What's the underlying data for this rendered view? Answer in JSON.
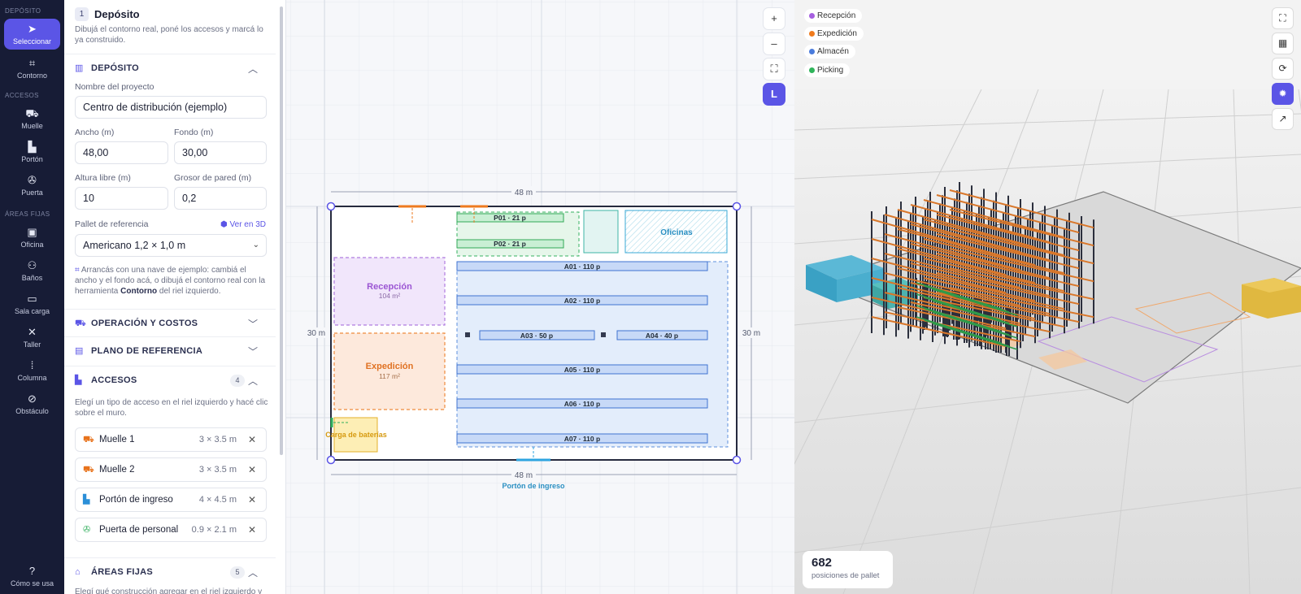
{
  "rail": {
    "sections": [
      {
        "label": "DEPÓSITO"
      },
      {
        "label": "ACCESOS"
      },
      {
        "label": "ÁREAS FIJAS"
      }
    ],
    "items": [
      {
        "label": "Seleccionar",
        "icon": "cursor-icon"
      },
      {
        "label": "Contorno",
        "icon": "contour-icon"
      },
      {
        "label": "Muelle",
        "icon": "dock-icon"
      },
      {
        "label": "Portón",
        "icon": "gate-icon"
      },
      {
        "label": "Puerta",
        "icon": "door-icon"
      },
      {
        "label": "Oficina",
        "icon": "office-icon"
      },
      {
        "label": "Baños",
        "icon": "restroom-icon"
      },
      {
        "label": "Sala carga",
        "icon": "charging-room-icon"
      },
      {
        "label": "Taller",
        "icon": "tools-icon"
      },
      {
        "label": "Columna",
        "icon": "column-icon"
      },
      {
        "label": "Obstáculo",
        "icon": "obstacle-icon"
      }
    ],
    "help": {
      "label": "Cómo se usa",
      "icon": "help-icon"
    }
  },
  "panel": {
    "step": "1",
    "title": "Depósito",
    "subtitle": "Dibujá el contorno real, poné los accesos y marcá lo ya construido.",
    "deposito": {
      "title": "DEPÓSITO",
      "project_label": "Nombre del proyecto",
      "project_value": "Centro de distribución (ejemplo)",
      "width_label": "Ancho (m)",
      "width_value": "48,00",
      "depth_label": "Fondo (m)",
      "depth_value": "30,00",
      "height_label": "Altura libre (m)",
      "height_value": "10",
      "wall_label": "Grosor de pared (m)",
      "wall_value": "0,2",
      "pallet_label": "Pallet de referencia",
      "view3d_link": "Ver en 3D",
      "pallet_value": "Americano 1,2 × 1,0 m",
      "hint_pre": "Arrancás con una nave de ejemplo: cambiá el ancho y el fondo acá, o dibujá el contorno real con la herramienta ",
      "hint_bold": "Contorno",
      "hint_post": " del riel izquierdo."
    },
    "operacion": {
      "title": "OPERACIÓN Y COSTOS"
    },
    "plano": {
      "title": "PLANO DE REFERENCIA"
    },
    "accesos": {
      "title": "ACCESOS",
      "count": "4",
      "hint": "Elegí un tipo de acceso en el riel izquierdo y hacé clic sobre el muro.",
      "items": [
        {
          "name": "Muelle 1",
          "size": "3 × 3.5 m",
          "color": "#e8731c"
        },
        {
          "name": "Muelle 2",
          "size": "3 × 3.5 m",
          "color": "#e8731c"
        },
        {
          "name": "Portón de ingreso",
          "size": "4 × 4.5 m",
          "color": "#2b8fd8"
        },
        {
          "name": "Puerta de personal",
          "size": "0.9 × 2.1 m",
          "color": "#2fae5a"
        }
      ]
    },
    "areas": {
      "title": "ÁREAS FIJAS",
      "count": "5",
      "hint": "Elegí qué construcción agregar en el riel izquierdo y"
    }
  },
  "plan": {
    "dim_top": "48 m",
    "dim_bottom": "48 m",
    "dim_left": "30 m",
    "dim_right": "30 m",
    "gate_label": "Portón de ingreso",
    "recepcion": {
      "name": "Recepción",
      "area": "104 m²"
    },
    "expedicion": {
      "name": "Expedición",
      "area": "117 m²"
    },
    "oficinas": "Oficinas",
    "carga": "Carga de baterías",
    "racks": [
      "P01 · 21 p",
      "P02 · 21 p",
      "A01 · 110 p",
      "A02 · 110 p",
      "A03 · 50 p",
      "A04 · 40 p",
      "A05 · 110 p",
      "A06 · 110 p",
      "A07 · 110 p"
    ],
    "buttons": [
      {
        "symbol": "+"
      },
      {
        "symbol": "–"
      },
      {
        "symbol": "⛶"
      },
      {
        "symbol": "L"
      }
    ]
  },
  "view3d": {
    "legend": [
      {
        "label": "Recepción",
        "color": "#a65fe0"
      },
      {
        "label": "Expedición",
        "color": "#f07a1c"
      },
      {
        "label": "Almacén",
        "color": "#4a7bdc"
      },
      {
        "label": "Picking",
        "color": "#2fb45a"
      }
    ],
    "buttons": [
      {
        "symbol": "⛶"
      },
      {
        "symbol": "▦"
      },
      {
        "symbol": "⟳"
      },
      {
        "symbol": "✹"
      },
      {
        "symbol": "↗"
      }
    ],
    "stats_value": "682",
    "stats_label": "posiciones de pallet"
  }
}
